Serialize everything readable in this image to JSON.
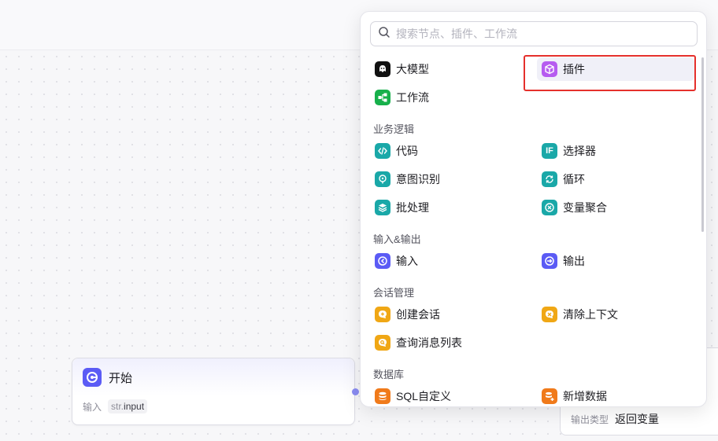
{
  "canvas": {
    "start_node": {
      "title": "开始",
      "input_label": "输入",
      "var_prefix": "str.",
      "var_name": "input"
    },
    "end_node": {
      "output_type_label": "输出类型",
      "output_type_value": "返回变量"
    }
  },
  "panel": {
    "search": {
      "placeholder": "搜索节点、插件、工作流",
      "value": ""
    },
    "top_items": [
      {
        "label": "大模型",
        "icon": "llm-icon",
        "color": "#111111"
      },
      {
        "label": "插件",
        "icon": "plugin-cube-icon",
        "color": "#b65cf0",
        "highlighted": true
      },
      {
        "label": "工作流",
        "icon": "workflow-icon",
        "color": "#17b04b"
      }
    ],
    "sections": [
      {
        "title": "业务逻辑",
        "items": [
          {
            "label": "代码",
            "icon": "code-icon",
            "color": "#1aa8a8"
          },
          {
            "label": "选择器",
            "icon": "if-icon",
            "color": "#1aa8a8"
          },
          {
            "label": "意图识别",
            "icon": "intent-icon",
            "color": "#1aa8a8"
          },
          {
            "label": "循环",
            "icon": "loop-icon",
            "color": "#1aa8a8"
          },
          {
            "label": "批处理",
            "icon": "batch-icon",
            "color": "#1aa8a8"
          },
          {
            "label": "变量聚合",
            "icon": "aggregate-icon",
            "color": "#1aa8a8"
          }
        ]
      },
      {
        "title": "输入&输出",
        "items": [
          {
            "label": "输入",
            "icon": "input-icon",
            "color": "#5b5bf5"
          },
          {
            "label": "输出",
            "icon": "output-icon",
            "color": "#5b5bf5"
          }
        ]
      },
      {
        "title": "会话管理",
        "items": [
          {
            "label": "创建会话",
            "icon": "create-conversation-icon",
            "color": "#f0a715"
          },
          {
            "label": "清除上下文",
            "icon": "clear-context-icon",
            "color": "#f0a715"
          },
          {
            "label": "查询消息列表",
            "icon": "query-messages-icon",
            "color": "#f0a715"
          }
        ]
      },
      {
        "title": "数据库",
        "items": [
          {
            "label": "SQL自定义",
            "icon": "sql-icon",
            "color": "#f07a1a"
          },
          {
            "label": "新增数据",
            "icon": "add-data-icon",
            "color": "#f07a1a"
          }
        ]
      }
    ]
  }
}
